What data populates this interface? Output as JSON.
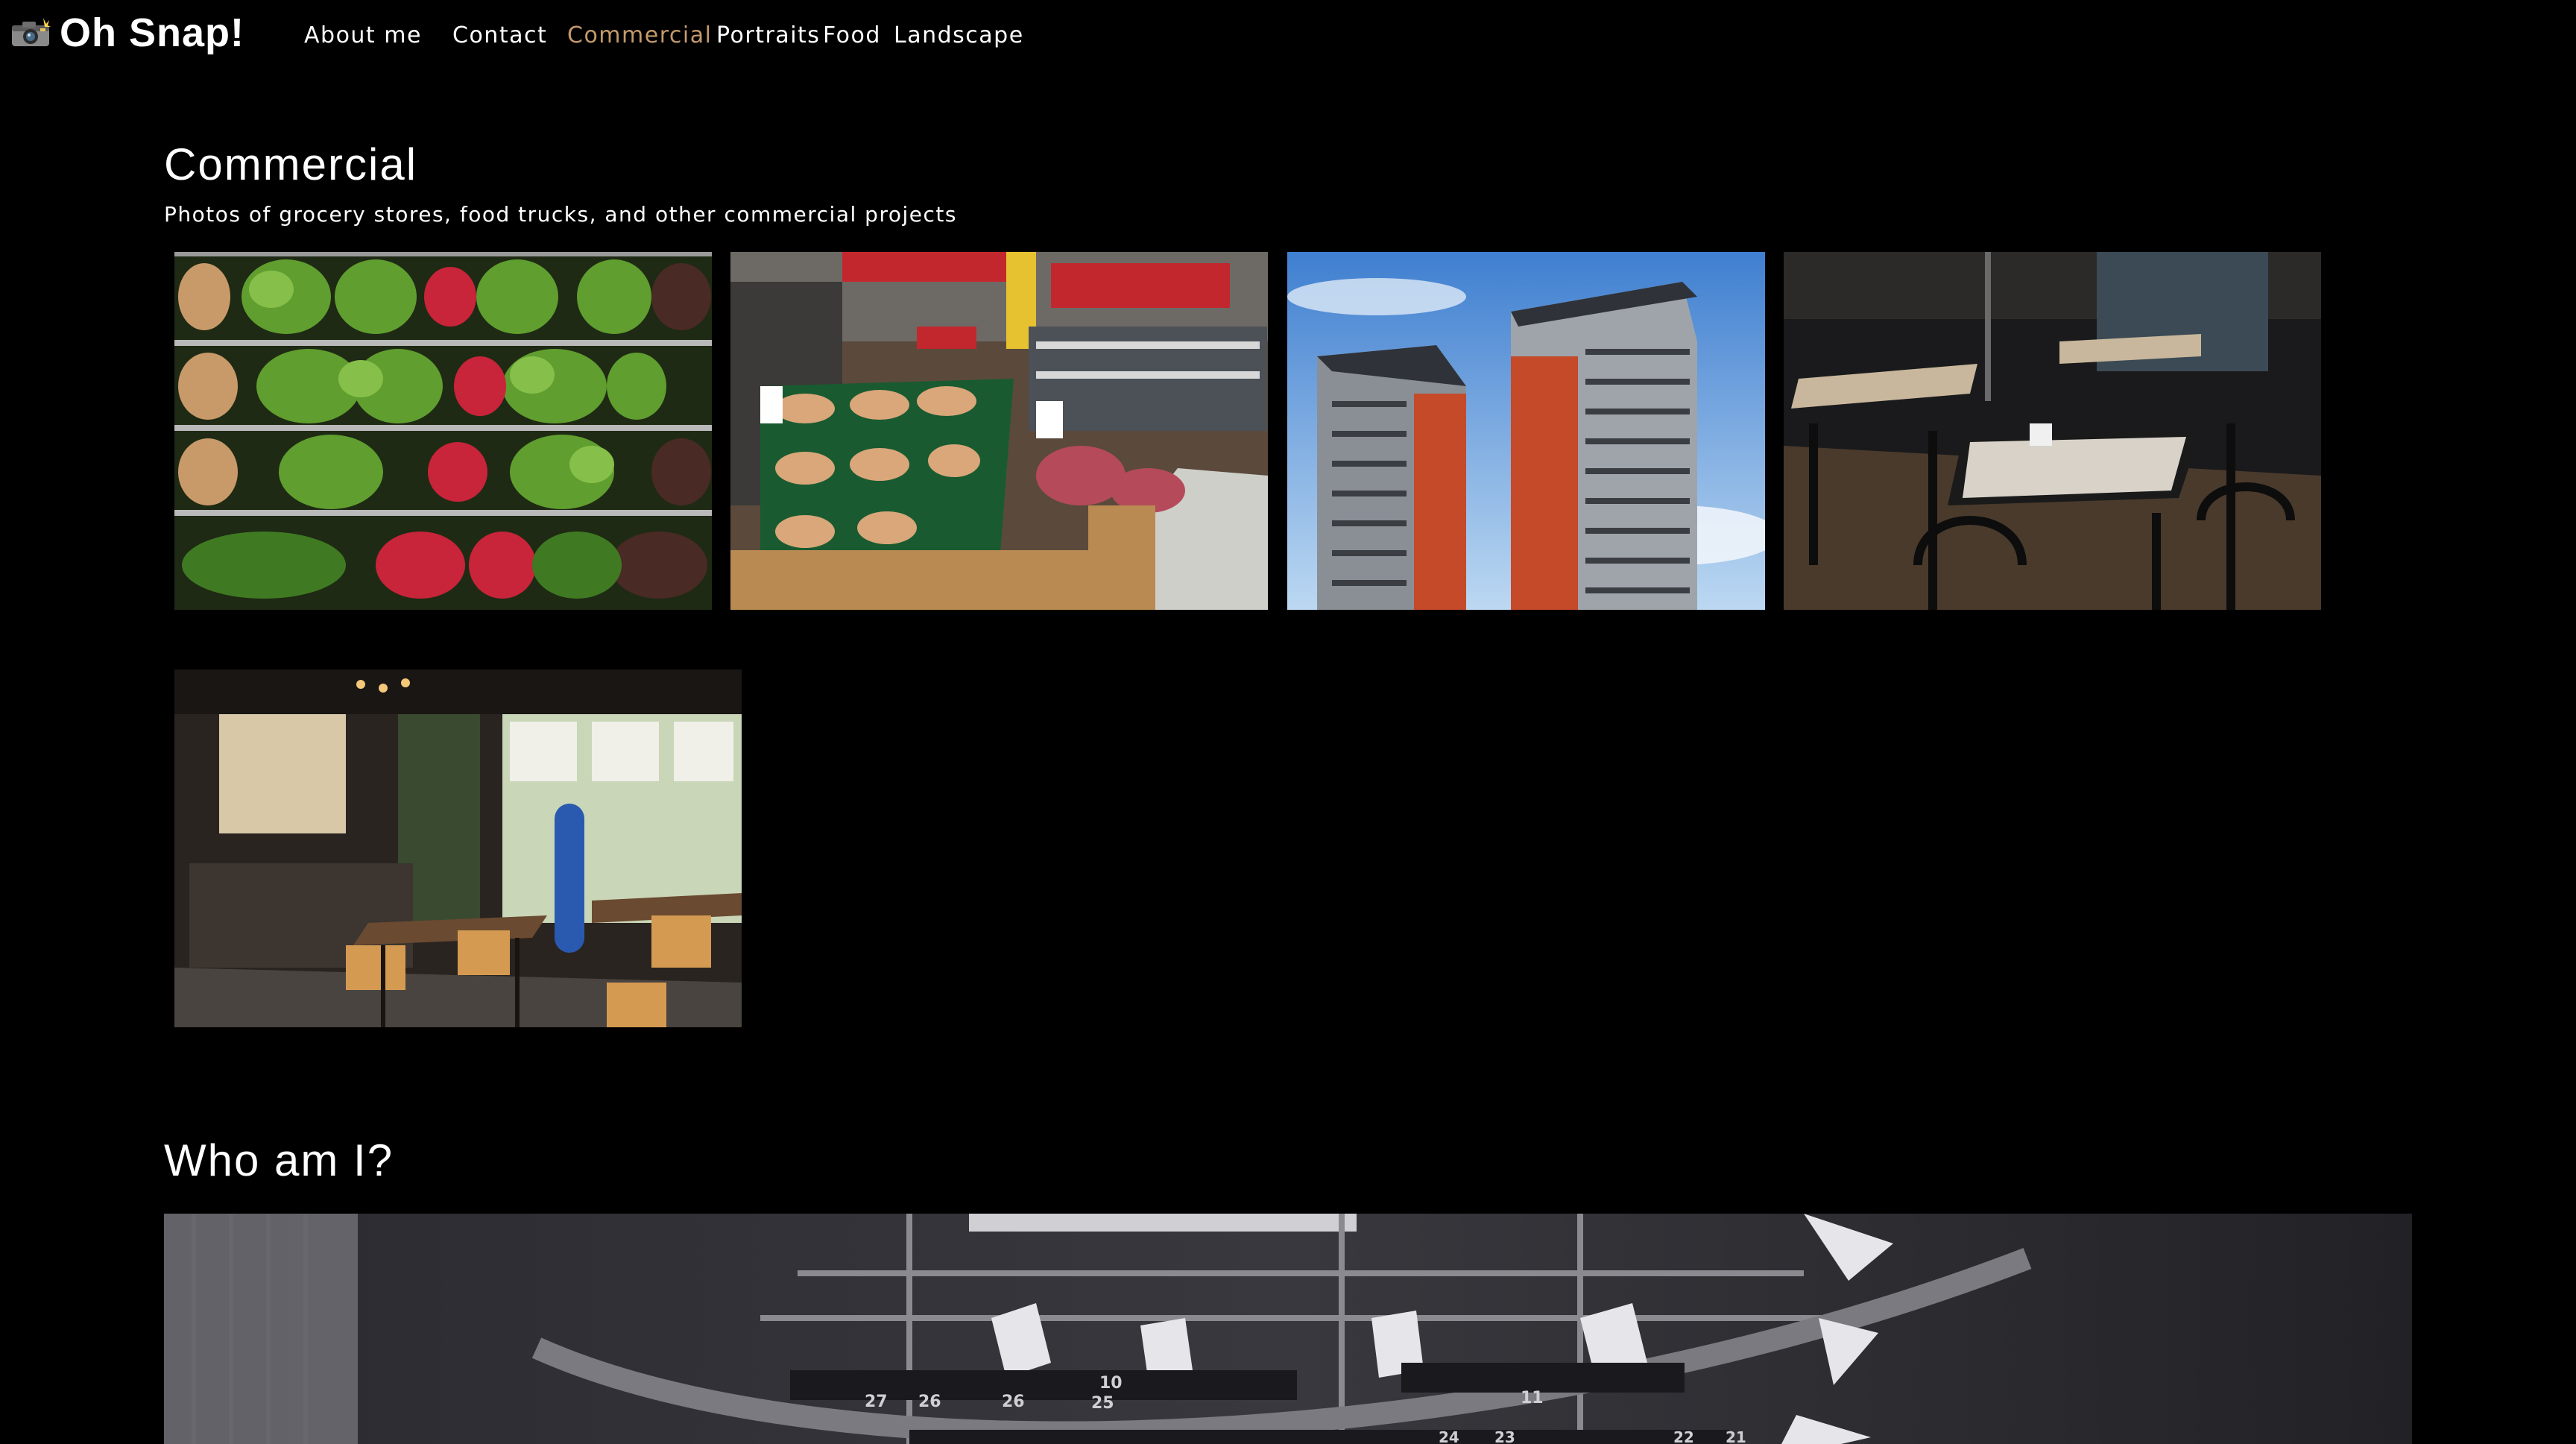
{
  "brand": {
    "name": "Oh Snap!",
    "icon": "camera-flash-icon"
  },
  "nav": {
    "items": [
      {
        "label": "About me",
        "active": false
      },
      {
        "label": "Contact",
        "active": false
      },
      {
        "label": "Commercial",
        "active": true
      },
      {
        "label": "Portraits",
        "active": false
      },
      {
        "label": "Food",
        "active": false
      },
      {
        "label": "Landscape",
        "active": false
      }
    ]
  },
  "commercial": {
    "title": "Commercial",
    "subtitle": "Photos of grocery stores, food trucks, and other commercial projects",
    "photos": [
      {
        "subject": "produce-shelves"
      },
      {
        "subject": "supermarket-aisle"
      },
      {
        "subject": "apartment-towers"
      },
      {
        "subject": "dark-restaurant-tables"
      },
      {
        "subject": "cafe-interior"
      }
    ]
  },
  "about": {
    "title": "Who am I?",
    "hero_subject": "photo-studio-lighting-rig",
    "rig_labels": [
      "27",
      "26",
      "26",
      "25",
      "10",
      "11",
      "24",
      "23",
      "22",
      "21"
    ]
  },
  "colors": {
    "background": "#000000",
    "text": "#ffffff",
    "nav_active": "#c49a6c"
  }
}
